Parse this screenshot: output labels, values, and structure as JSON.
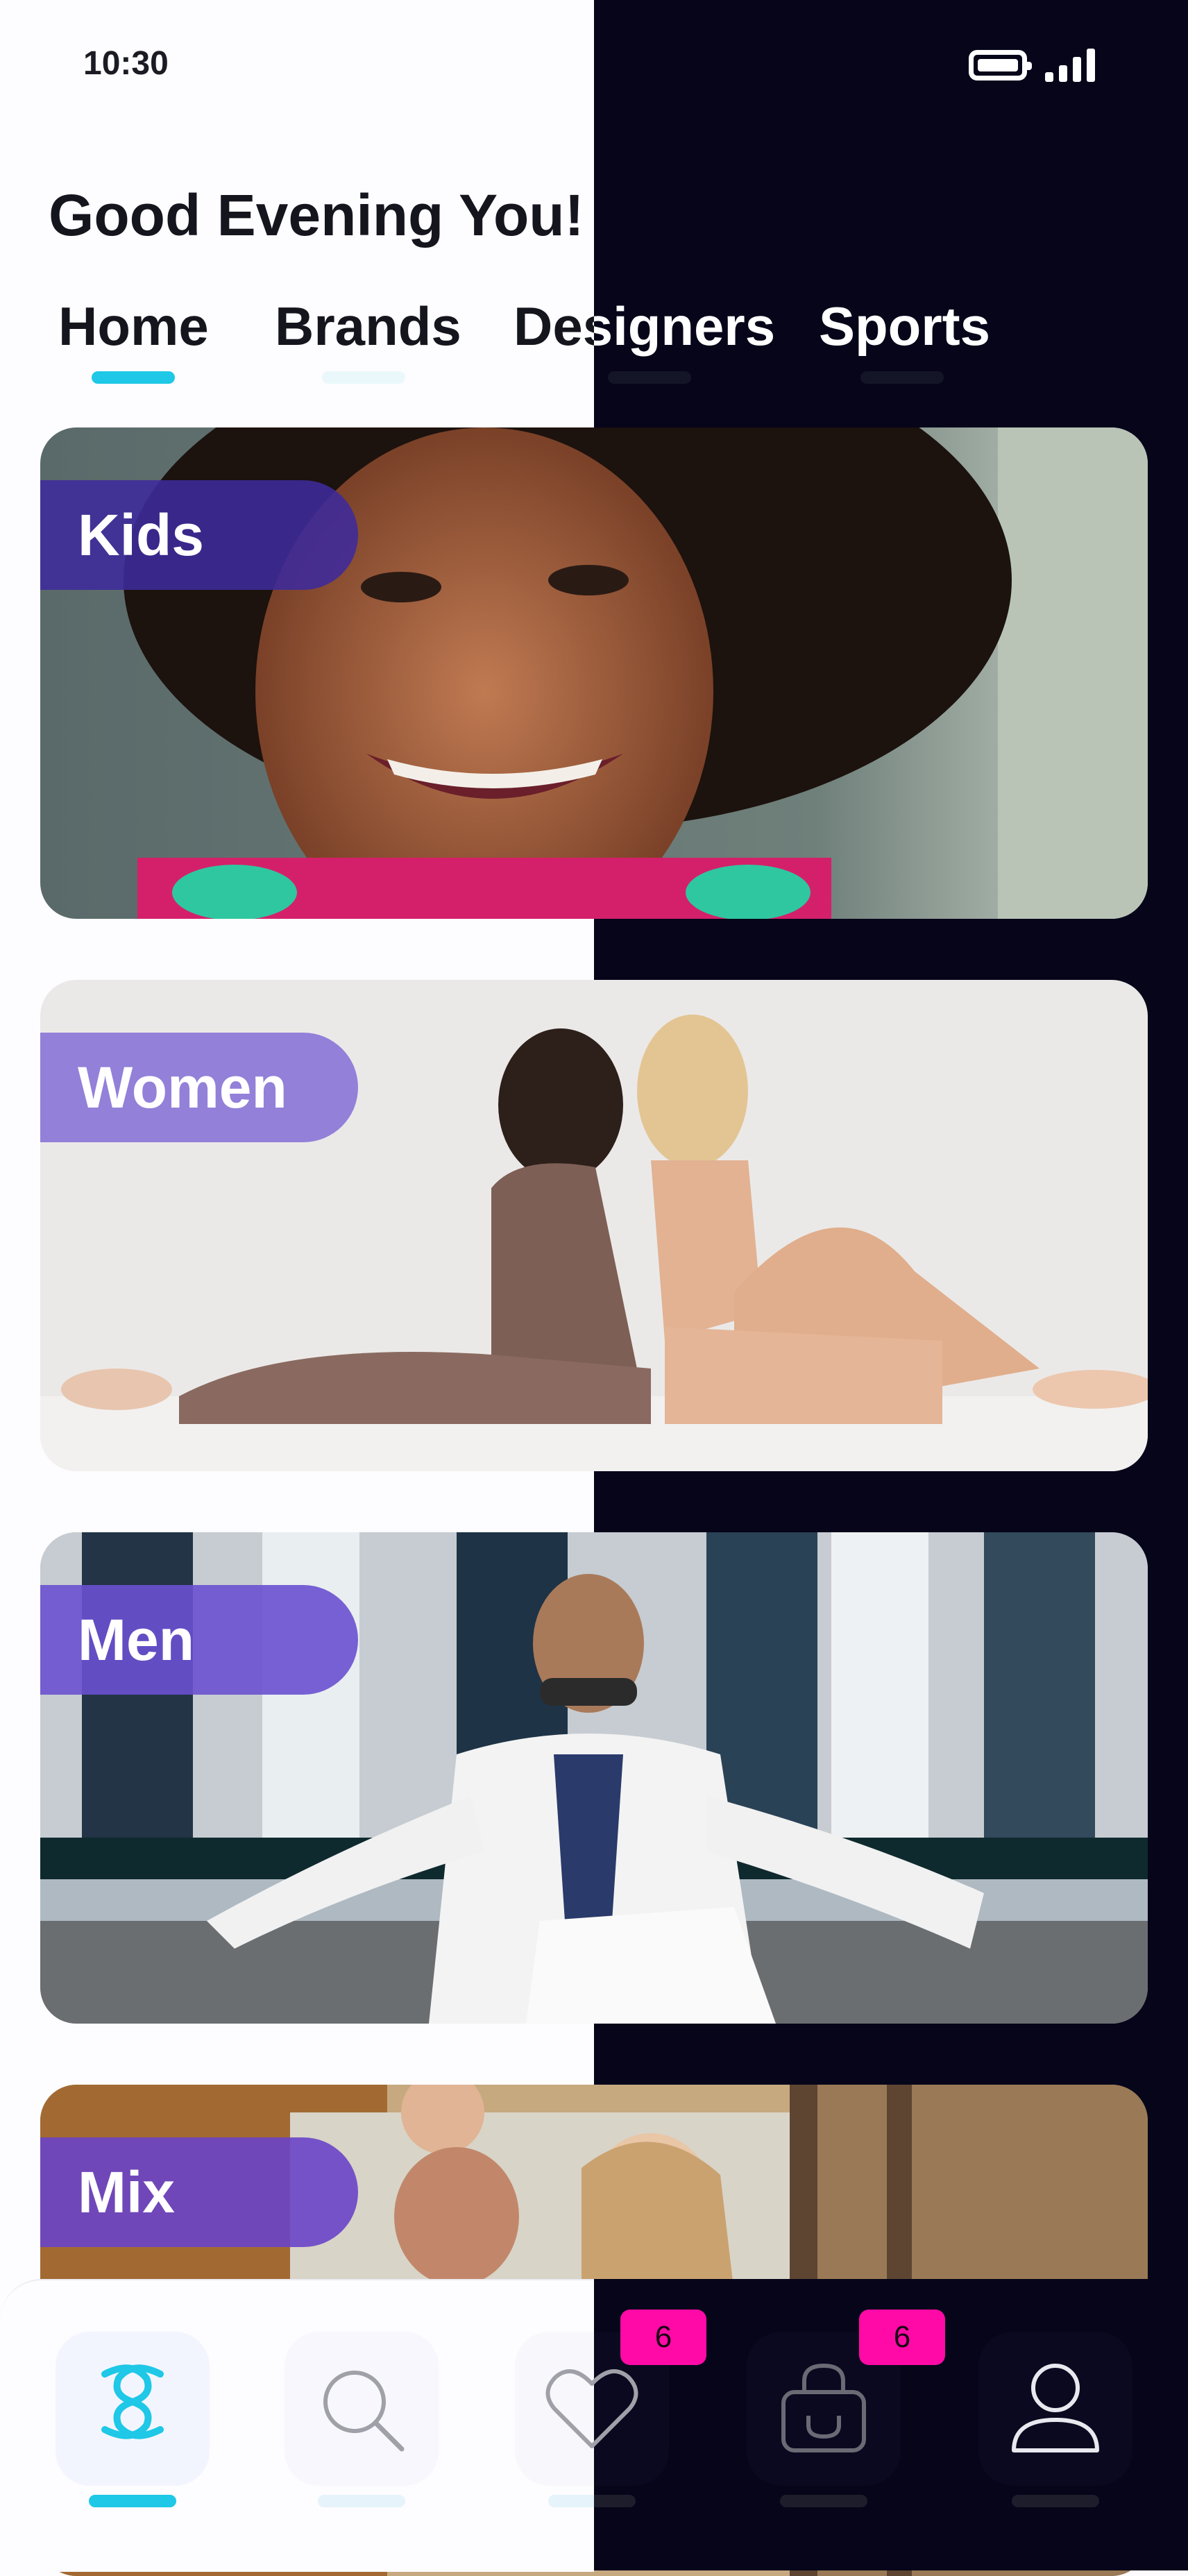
{
  "status_bar": {
    "time": "10:30",
    "battery_icon": "battery-icon",
    "signal_icon": "signal-icon"
  },
  "greeting": "Good Evening You!",
  "tabs": [
    {
      "label": "Home",
      "active": true
    },
    {
      "label": "Brands",
      "active": false
    },
    {
      "label": "Designers",
      "active": false
    },
    {
      "label": "Sports",
      "active": false
    }
  ],
  "categories": [
    {
      "label": "Kids",
      "pill_color": "#3d2a9c",
      "photo": "smiling-child-photo"
    },
    {
      "label": "Women",
      "pill_color": "#8e7ad8",
      "photo": "two-women-sitting-photo"
    },
    {
      "label": "Men",
      "pill_color": "#6a50d0",
      "photo": "man-in-white-suit-photo"
    },
    {
      "label": "Mix",
      "pill_color": "#6a44c8",
      "photo": "family-outdoors-photo"
    }
  ],
  "bottom_nav": [
    {
      "icon": "logo-home-icon",
      "active": true
    },
    {
      "icon": "search-icon",
      "active": false
    },
    {
      "icon": "heart-icon",
      "active": false,
      "badge": "6"
    },
    {
      "icon": "shopping-bag-icon",
      "active": false,
      "badge": "6"
    },
    {
      "icon": "profile-icon",
      "active": false
    }
  ],
  "colors": {
    "accent": "#1ec8e6",
    "badge": "#ff0aa6",
    "dark_half": "#06051a",
    "light_half": "#fdfcfe"
  }
}
